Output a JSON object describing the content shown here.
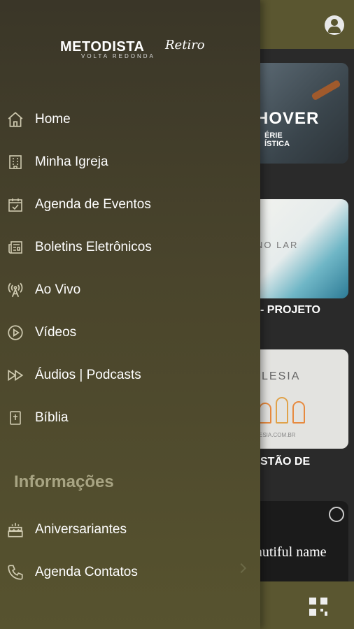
{
  "drawer": {
    "logo": {
      "main": "METODISTA",
      "script": "Retiro",
      "sub": "VOLTA REDONDA"
    },
    "menu": [
      {
        "label": "Home",
        "icon": "home-icon"
      },
      {
        "label": "Minha Igreja",
        "icon": "building-icon"
      },
      {
        "label": "Agenda de Eventos",
        "icon": "calendar-icon"
      },
      {
        "label": "Boletins Eletrônicos",
        "icon": "newspaper-icon"
      },
      {
        "label": "Ao Vivo",
        "icon": "broadcast-icon"
      },
      {
        "label": "Vídeos",
        "icon": "play-circle-icon"
      },
      {
        "label": "Áudios | Podcasts",
        "icon": "fast-forward-icon"
      },
      {
        "label": "Bíblia",
        "icon": "bible-icon"
      }
    ],
    "info_section": {
      "title": "Informações",
      "items": [
        {
          "label": "Aniversariantes",
          "icon": "cake-icon"
        },
        {
          "label": "Agenda Contatos",
          "icon": "phone-icon"
        }
      ]
    }
  },
  "background": {
    "cards": [
      {
        "headline": "HOVER",
        "sub": "ÉRIE\nÍSTICA"
      },
      {
        "text": "NO LAR",
        "caption": "- PROJETO"
      },
      {
        "text": "LESIA",
        "url": "ESIA.COM.BR",
        "caption": "STÃO DE"
      },
      {
        "text": "autiful name"
      }
    ]
  },
  "colors": {
    "accent": "#5a5630",
    "drawer_top": "#3a3628",
    "drawer_bottom": "#57532f",
    "section": "#a8a483"
  }
}
